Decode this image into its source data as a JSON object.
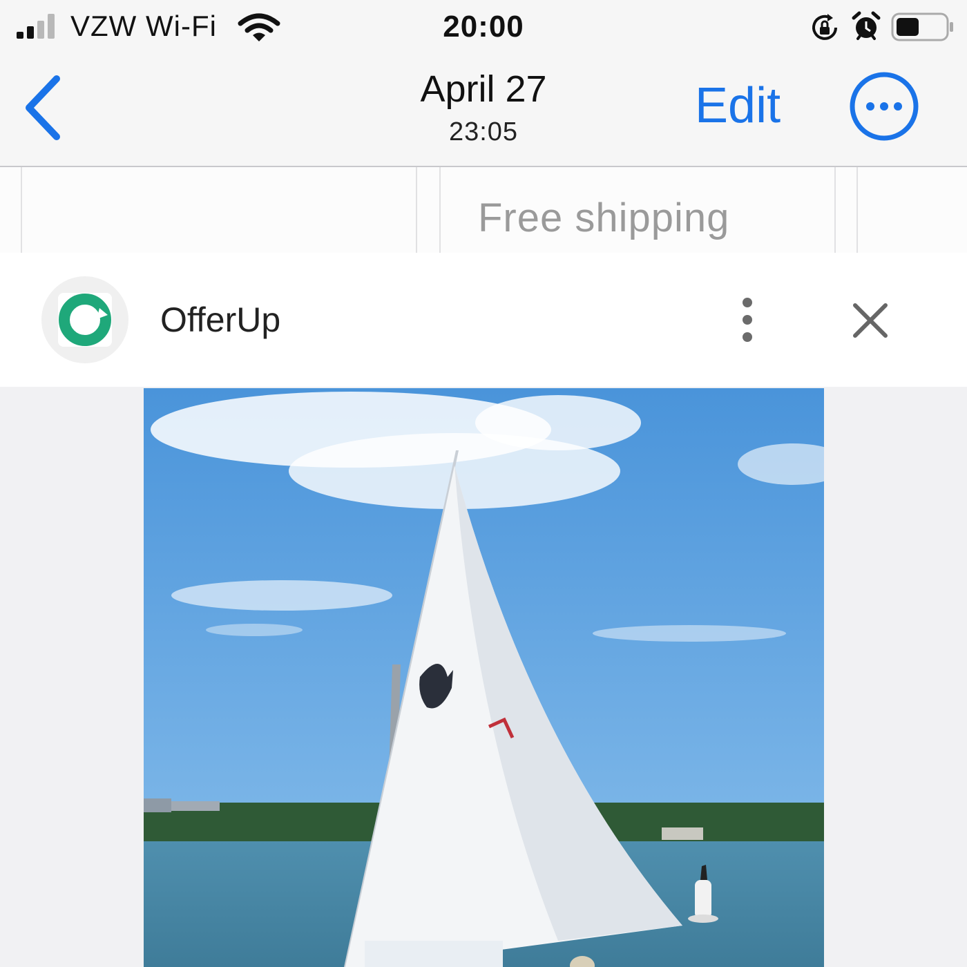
{
  "status_bar": {
    "carrier": "VZW Wi-Fi",
    "time": "20:00",
    "icons": [
      "cellular-signal-icon",
      "wifi-icon",
      "rotation-lock-icon",
      "alarm-icon",
      "battery-icon"
    ]
  },
  "nav": {
    "title": "April 27",
    "subtitle": "23:05",
    "edit_label": "Edit",
    "icons": [
      "chevron-left-icon",
      "more-circle-icon"
    ],
    "accent_color": "#1a73e8"
  },
  "web_content": {
    "free_shipping": "Free shipping"
  },
  "banner": {
    "app_name": "OfferUp",
    "logo_color": "#1fa87a",
    "icons": [
      "offerup-logo-icon",
      "kebab-menu-icon",
      "close-icon"
    ]
  },
  "photo": {
    "subject": "sailboat-photo"
  }
}
